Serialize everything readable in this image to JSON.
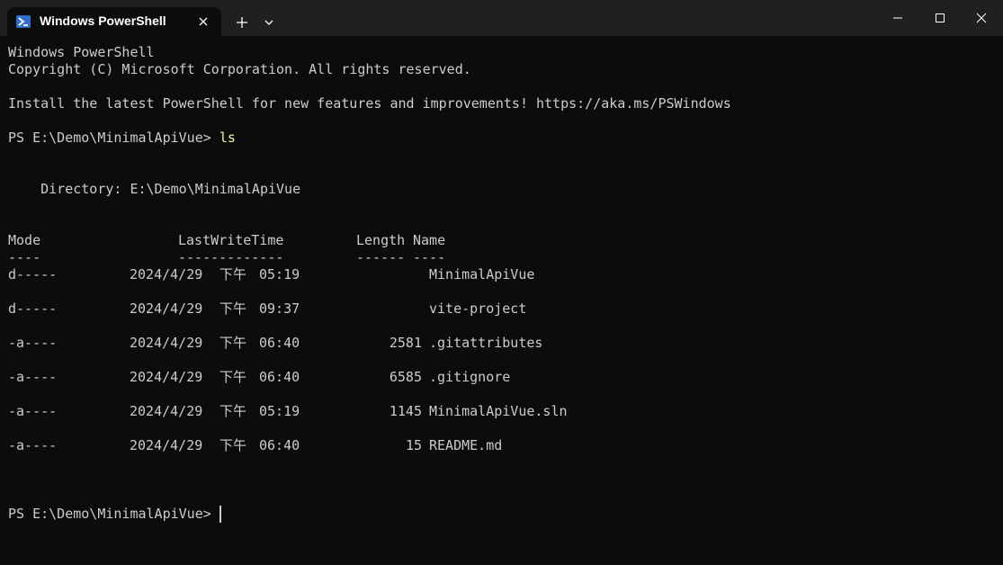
{
  "window": {
    "tab_title": "Windows PowerShell",
    "icons": {
      "tab": "powershell-icon",
      "close_tab": "close-icon",
      "new_tab": "plus-icon",
      "dropdown": "chevron-down-icon",
      "minimize": "minimize-icon",
      "maximize": "maximize-icon",
      "close_window": "close-icon"
    }
  },
  "colors": {
    "background": "#0c0c0c",
    "titlebar": "#202020",
    "text": "#cccccc",
    "command": "#f9f1a5",
    "icon_accent": "#2f6fcf"
  },
  "terminal": {
    "banner_1": "Windows PowerShell",
    "banner_2": "Copyright (C) Microsoft Corporation. All rights reserved.",
    "banner_3": "Install the latest PowerShell for new features and improvements! https://aka.ms/PSWindows",
    "prompt_1": "PS E:\\Demo\\MinimalApiVue> ",
    "command_1": "ls",
    "directory": "    Directory: E:\\Demo\\MinimalApiVue",
    "headers": {
      "mode": "Mode",
      "lastwrite": "LastWriteTime",
      "length": "Length",
      "name": "Name"
    },
    "underlines": {
      "mode": "----",
      "lastwrite": "-------------",
      "length": "------",
      "name": "----"
    },
    "rows": [
      {
        "mode": "d-----",
        "date": "2024/4/29",
        "ampm": "下午",
        "time": "05:19",
        "length": "",
        "name": "MinimalApiVue"
      },
      {
        "mode": "d-----",
        "date": "2024/4/29",
        "ampm": "下午",
        "time": "09:37",
        "length": "",
        "name": "vite-project"
      },
      {
        "mode": "-a----",
        "date": "2024/4/29",
        "ampm": "下午",
        "time": "06:40",
        "length": "2581",
        "name": ".gitattributes"
      },
      {
        "mode": "-a----",
        "date": "2024/4/29",
        "ampm": "下午",
        "time": "06:40",
        "length": "6585",
        "name": ".gitignore"
      },
      {
        "mode": "-a----",
        "date": "2024/4/29",
        "ampm": "下午",
        "time": "05:19",
        "length": "1145",
        "name": "MinimalApiVue.sln"
      },
      {
        "mode": "-a----",
        "date": "2024/4/29",
        "ampm": "下午",
        "time": "06:40",
        "length": "15",
        "name": "README.md"
      }
    ],
    "prompt_2": "PS E:\\Demo\\MinimalApiVue>"
  }
}
